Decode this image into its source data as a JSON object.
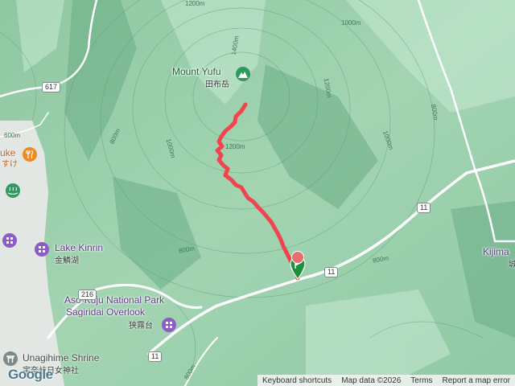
{
  "map": {
    "colors": {
      "terrain": "#9fd1b0",
      "ridge": "#c6e8d2",
      "valley": "#79b995",
      "road": "#ffffff",
      "route": "#f0454f",
      "town": "#dfe3e0",
      "purple_poi": "#8e5cc7",
      "orange_poi": "#f08a24"
    },
    "peak": {
      "name": "Mount Yufu",
      "local_name": "田布岳",
      "icon": "mountain-icon"
    },
    "lake": {
      "name": "Lake Kinrin",
      "local_name": "金鱗湖",
      "icon": "purple-poi-icon"
    },
    "park": {
      "name_line1": "Aso-Kuju National Park",
      "name_line2": "Sagiridai Overlook",
      "local_name": "狭霧台",
      "icon": "purple-poi-icon"
    },
    "shrine": {
      "name": "Unagihime Shrine",
      "local_name": "宇奈岐日女神社",
      "icon": "shrine-icon"
    },
    "restaurant": {
      "name": "uke",
      "local_name": "すけ",
      "icon": "restaurant-icon"
    },
    "kijima": {
      "name": "Kijima",
      "local_name": "城"
    },
    "roads": [
      "617",
      "11",
      "11",
      "216",
      "11"
    ],
    "elevations": {
      "e1200": "1200m",
      "e1400": "1400m",
      "e1000a": "1000m",
      "e1200b": "1200m",
      "e800a": "800m",
      "e1000b": "1000m",
      "e1000c": "1000m",
      "e800b": "800m",
      "e600": "600m",
      "e800c": "800m",
      "e800d": "800m",
      "e800e": "800m",
      "e1200c": "1200m"
    },
    "track": {
      "start_marker": "start-flag-icon",
      "color": "#f0454f"
    },
    "attribution": {
      "logo": "Google",
      "keyboard": "Keyboard shortcuts",
      "map_data": "Map data ©2026",
      "terms": "Terms",
      "report": "Report a map error"
    }
  }
}
